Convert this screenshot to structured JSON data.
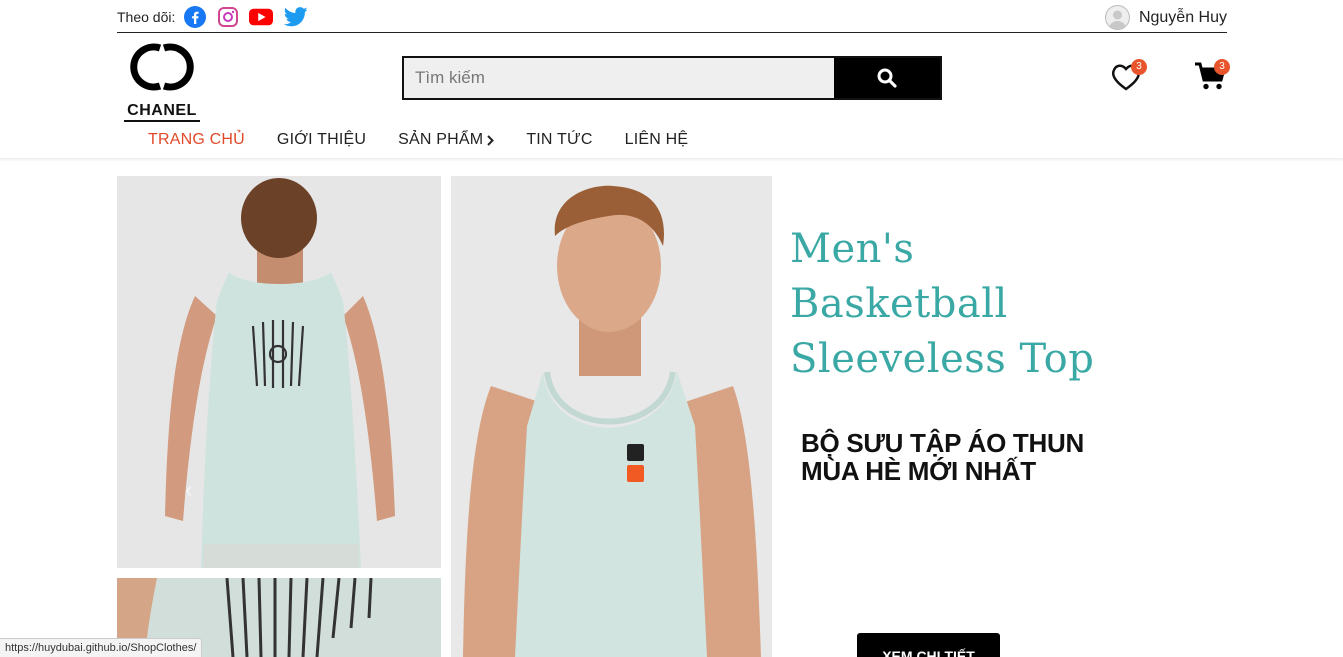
{
  "topbar": {
    "follow_label": "Theo dõi:",
    "social": [
      "facebook-icon",
      "instagram-icon",
      "youtube-icon",
      "twitter-icon"
    ],
    "user_name": "Nguyễn Huy"
  },
  "header": {
    "logo_text": "CHANEL",
    "search_placeholder": "Tìm kiếm",
    "wishlist_count": "3",
    "cart_count": "3"
  },
  "nav": {
    "items": [
      "TRANG CHỦ",
      "GIỚI THIỆU",
      "SẢN PHẨM",
      "TIN TỨC",
      "LIÊN HỆ"
    ],
    "active": "TRANG CHỦ"
  },
  "banner": {
    "title_lines": [
      "Men's",
      "Basketball",
      "Sleeveless Top"
    ],
    "subtitle_lines": [
      "BỘ SƯU TẬP ÁO THUN",
      "MÙA HÈ MỚI NHẤT"
    ],
    "cta_label": "XEM CHI TIẾT"
  },
  "status": {
    "url": "https://huydubai.github.io/ShopClothes/"
  },
  "colors": {
    "accent": "#e04a2b",
    "promo_teal": "#3aa8a4",
    "badge": "#e8552d"
  }
}
